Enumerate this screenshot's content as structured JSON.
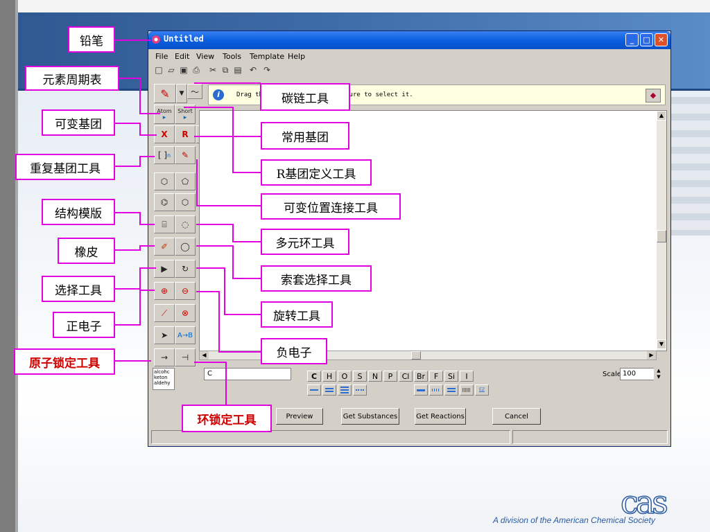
{
  "window": {
    "title": "Untitled",
    "minimize": "_",
    "maximize": "□",
    "close": "✕"
  },
  "menu": {
    "file": "File",
    "edit": "Edit",
    "view": "View",
    "tools": "Tools",
    "template": "Template",
    "help": "Help"
  },
  "info": {
    "message": "Drag the mouse around a structure to select it."
  },
  "palette": {
    "atom": "Atom",
    "short": "Short",
    "x_label": "X",
    "r_label": "R",
    "ring_label": "n",
    "a_to_b": "A→B",
    "arrow": "→",
    "alcohol": "alcohc",
    "ketone": "keton",
    "aldehyde": "aldehy"
  },
  "bottom": {
    "atom_input": "C",
    "atoms": [
      "C",
      "H",
      "O",
      "S",
      "N",
      "P",
      "Cl",
      "Br",
      "F",
      "Si",
      "I"
    ],
    "scale_label": "Scale",
    "scale_value": "100",
    "ez_label": "EZ",
    "preview": "Preview",
    "get_substances": "Get Substances",
    "get_reactions": "Get Reactions",
    "cancel": "Cancel"
  },
  "left_labels": {
    "pencil": "铅笔",
    "periodic_table": "元素周期表",
    "variable_group": "可变基团",
    "repeating_group_tool": "重复基团工具",
    "structure_template": "结构模版",
    "eraser": "橡皮",
    "select_tool": "选择工具",
    "positive_charge": "正电子",
    "atom_lock_tool": "原子锁定工具"
  },
  "right_labels": {
    "carbon_chain_tool": "碳链工具",
    "common_groups": "常用基团",
    "r_group_tool": "R基团定义工具",
    "variable_attach_tool": "可变位置连接工具",
    "multi_ring_tool": "多元环工具",
    "lasso_select_tool": "索套选择工具",
    "rotate_tool": "旋转工具",
    "negative_charge": "负电子",
    "ring_lock_tool": "环锁定工具"
  },
  "footer": {
    "logo": "cas",
    "tagline": "A division of the American Chemical Society"
  },
  "colors": {
    "label_border": "#e000e0",
    "title_blue": "#0a5fe0",
    "band_blue": "#3d6ba7",
    "footer_blue": "#2b5aa0",
    "red_label": "#d00000"
  }
}
